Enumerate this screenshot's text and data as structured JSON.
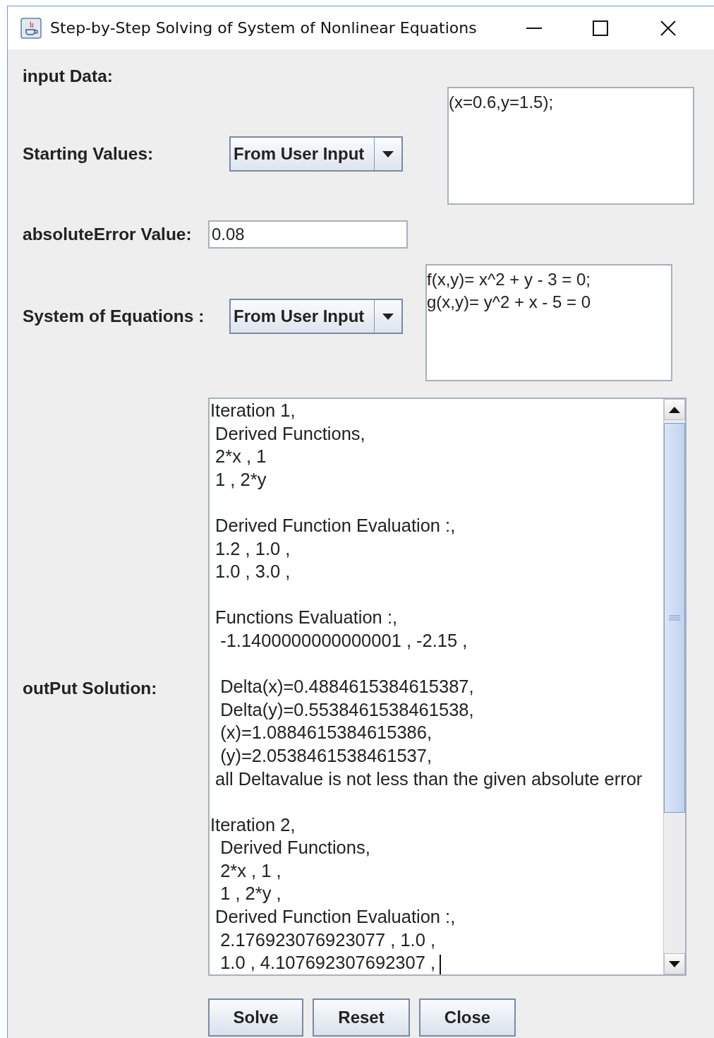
{
  "window": {
    "title": "Step-by-Step Solving of System of Nonlinear Equations"
  },
  "input_section": {
    "label": "input Data:"
  },
  "starting_values": {
    "label": "Starting Values:",
    "dropdown": "From User Input",
    "text": [
      "(x=0.6,y=1.5);"
    ]
  },
  "absolute_error": {
    "label": "absoluteError Value:",
    "value": "0.08"
  },
  "system_of_equations": {
    "label": "System of Equations :",
    "dropdown": "From User Input",
    "text": [
      "f(x,y)= x^2 + y - 3 = 0;",
      "g(x,y)= y^2 + x - 5 = 0"
    ]
  },
  "output": {
    "label": "outPut Solution:",
    "blocks": [
      [
        "Iteration 1,",
        " Derived Functions,",
        " 2*x , 1",
        " 1 , 2*y"
      ],
      [
        " Derived Function Evaluation :,",
        " 1.2 , 1.0 ,",
        " 1.0 , 3.0 ,"
      ],
      [
        " Functions Evaluation :,",
        "  -1.1400000000000001 , -2.15 ,"
      ],
      [
        "  Delta(x)=0.4884615384615387,",
        "  Delta(y)=0.5538461538461538,",
        "  (x)=1.0884615384615386,",
        "  (y)=2.0538461538461537,",
        " all Deltavalue is not less than the given absolute error"
      ],
      [
        "Iteration 2,",
        "  Derived Functions,",
        "  2*x , 1 ,",
        "  1 , 2*y ,",
        " Derived Function Evaluation :,",
        "  2.176923076923077 , 1.0 ,",
        "  1.0 , 4.107692307692307 ,"
      ]
    ]
  },
  "buttons": [
    "Solve",
    "Reset",
    "Close"
  ]
}
